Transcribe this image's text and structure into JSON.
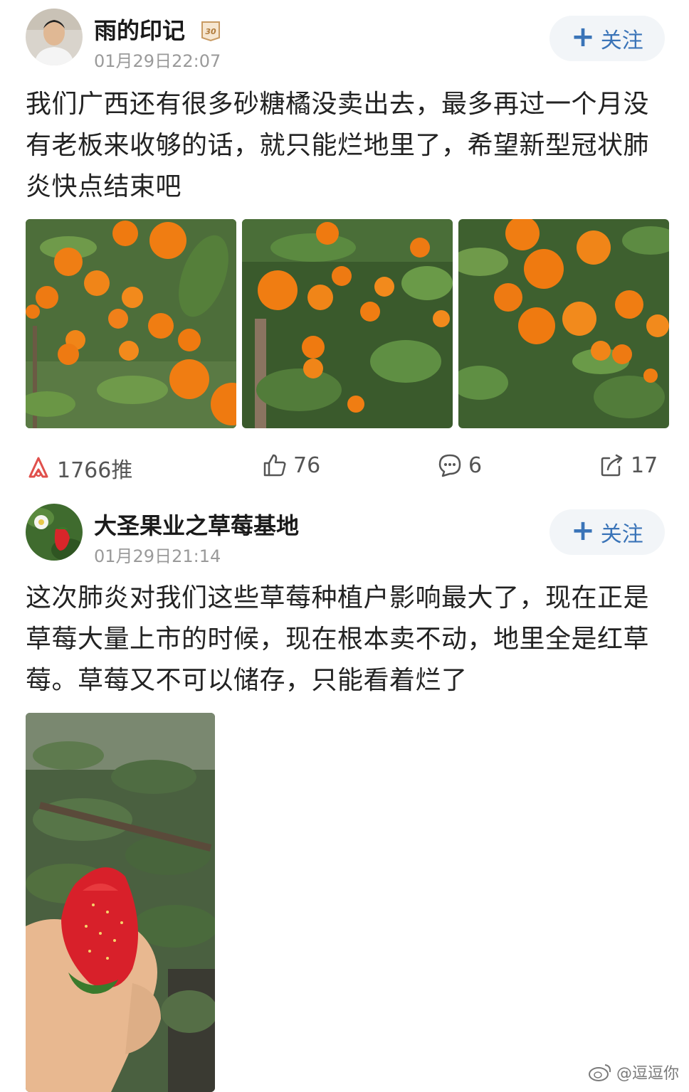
{
  "posts": [
    {
      "username": "雨的印记",
      "badge_text": "30",
      "timestamp": "01月29日22:07",
      "follow_label": "关注",
      "text": "我们广西还有很多砂糖橘没卖出去，最多再过一个月没有老板来收够的话，就只能烂地里了，希望新型冠状肺炎快点结束吧",
      "actions": {
        "push": "1766推",
        "likes": "76",
        "comments": "6",
        "reposts": "17"
      }
    },
    {
      "username": "大圣果业之草莓基地",
      "timestamp": "01月29日21:14",
      "follow_label": "关注",
      "text": "这次肺炎对我们这些草莓种植户影响最大了，现在正是草莓大量上市的时候，现在根本卖不动，地里全是红草莓。草莓又不可以储存，只能看着烂了"
    }
  ],
  "watermark": "@逗逗你",
  "colors": {
    "follow_text": "#3a74b8",
    "follow_bg": "#f2f5f8",
    "push_icon": "#e0504c",
    "meta_text": "#9a9a9a"
  }
}
